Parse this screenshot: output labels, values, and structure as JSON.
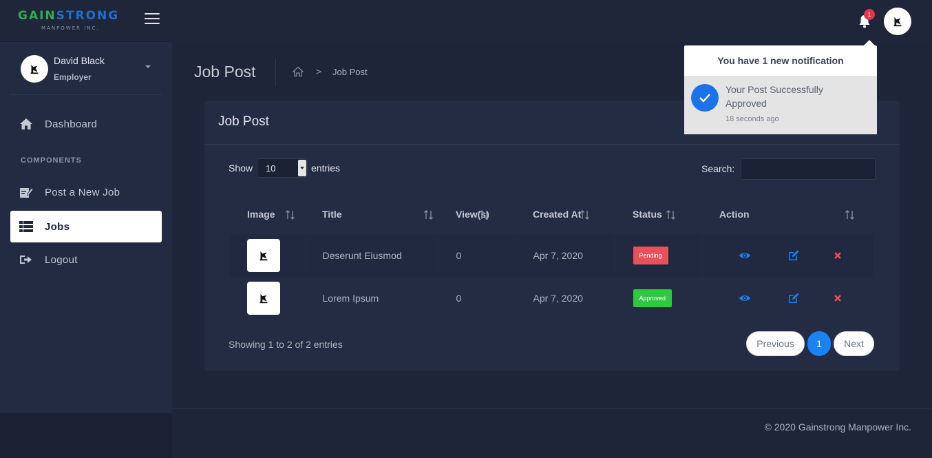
{
  "brand": {
    "name_part1": "GAIN",
    "name_part2": "STRONG",
    "sub": "MANPOWER INC."
  },
  "profile": {
    "name": "David Black",
    "role": "Employer"
  },
  "sidebar": {
    "items": [
      {
        "label": "Dashboard",
        "icon": "home-icon"
      },
      {
        "label": "Post a New Job",
        "icon": "edit-note-icon"
      },
      {
        "label": "Jobs",
        "icon": "list-icon",
        "active": true
      },
      {
        "label": "Logout",
        "icon": "logout-icon"
      }
    ],
    "section": "COMPONENTS"
  },
  "topbar": {
    "notification_count": "1"
  },
  "page": {
    "title": "Job Post",
    "breadcrumb_current": "Job Post"
  },
  "card": {
    "title": "Job Post",
    "show_label": "Show",
    "entries_value": "10",
    "entries_label": "entries",
    "search_label": "Search:",
    "search_value": ""
  },
  "table": {
    "headers": [
      "Image",
      "Title",
      "View(s)",
      "Created At",
      "Status",
      "Action"
    ],
    "rows": [
      {
        "title": "Deserunt Eiusmod",
        "views": "0",
        "created": "Apr 7, 2020",
        "status": "Pending"
      },
      {
        "title": "Lorem Ipsum",
        "views": "0",
        "created": "Apr 7, 2020",
        "status": "Approved"
      }
    ]
  },
  "pagination": {
    "showing": "Showing 1 to 2 of 2 entries",
    "previous": "Previous",
    "page": "1",
    "next": "Next"
  },
  "notification": {
    "header": "You have 1 new notification",
    "message": "Your Post Successfully Approved",
    "time": "18 seconds ago"
  },
  "footer": {
    "text": "© 2020 Gainstrong Manpower Inc."
  },
  "colors": {
    "accent": "#1a82f5",
    "pending": "#e9505a",
    "approved": "#2ec940",
    "sidebar_bg": "#232b42",
    "page_bg": "#1e2538"
  }
}
